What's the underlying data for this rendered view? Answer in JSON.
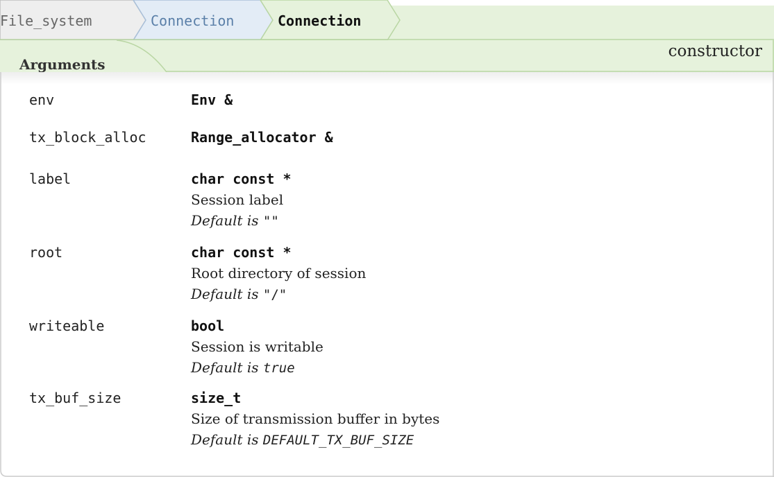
{
  "breadcrumb": {
    "items": [
      "File_system",
      "Connection",
      "Connection"
    ]
  },
  "section": {
    "tab_label": "Arguments",
    "kind": "constructor"
  },
  "arguments": [
    {
      "name": "env",
      "type": "Env &",
      "description": "",
      "default_label": "",
      "default_value": ""
    },
    {
      "name": "tx_block_alloc",
      "type": "Range_allocator &",
      "description": "",
      "default_label": "",
      "default_value": ""
    },
    {
      "name": "label",
      "type": "char const *",
      "description": "Session label",
      "default_label": "Default is",
      "default_value": "\"\""
    },
    {
      "name": "root",
      "type": "char const *",
      "description": "Root directory of session",
      "default_label": "Default is",
      "default_value": "\"/\""
    },
    {
      "name": "writeable",
      "type": "bool",
      "description": "Session is writable",
      "default_label": "Default is",
      "default_value": "true"
    },
    {
      "name": "tx_buf_size",
      "type": "size_t",
      "description": "Size of transmission buffer in bytes",
      "default_label": "Default is",
      "default_value": "DEFAULT_TX_BUF_SIZE"
    }
  ],
  "colors": {
    "header_green": "#e6f2dc",
    "crumb_blue": "#e3ecf6",
    "crumb_grey": "#eeeeee",
    "border_green": "#b9d6a3",
    "crumb_link": "#5a7fa8"
  }
}
